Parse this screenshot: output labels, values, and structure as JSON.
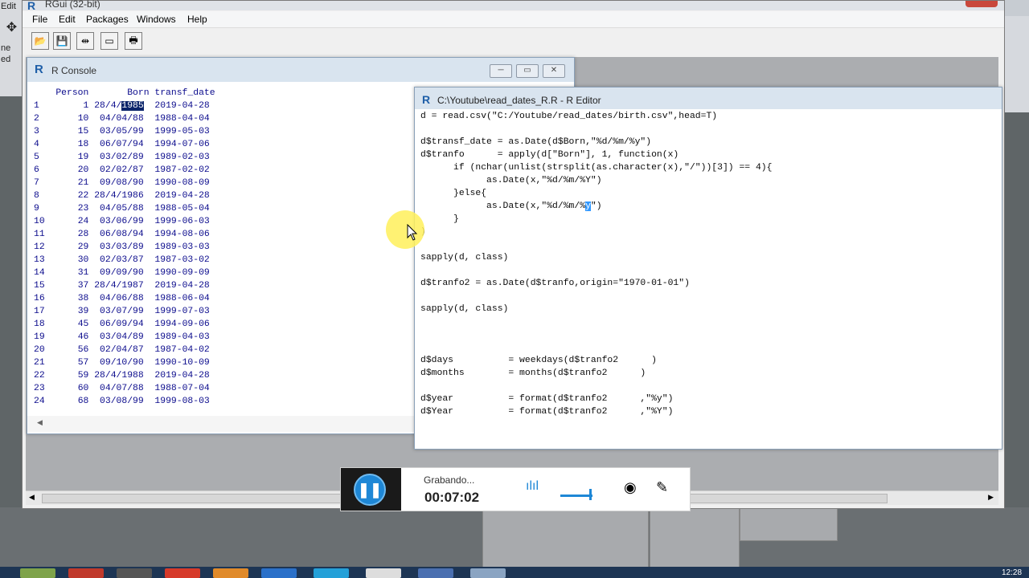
{
  "app": {
    "title": "RGui (32-bit)"
  },
  "left_strip": [
    "Edit",
    "ne",
    "ed"
  ],
  "menu": {
    "file": "File",
    "edit": "Edit",
    "packages": "Packages",
    "windows": "Windows",
    "help": "Help"
  },
  "toolbar": {
    "open_icon": "folder-open-icon",
    "save_icon": "save-icon",
    "copy_icon": "copy-paste-icon",
    "console_icon": "console-window-icon",
    "print_icon": "print-icon"
  },
  "console": {
    "title": "R Console",
    "header": "    Person       Born transf_date",
    "rows": [
      {
        "num": "1",
        "person": "1",
        "born_prefix": "28/4/",
        "born_sel": "1985",
        "date": "2019-04-28"
      },
      {
        "num": "2",
        "person": "10",
        "born": "04/04/88",
        "date": "1988-04-04"
      },
      {
        "num": "3",
        "person": "15",
        "born": "03/05/99",
        "date": "1999-05-03"
      },
      {
        "num": "4",
        "person": "18",
        "born": "06/07/94",
        "date": "1994-07-06"
      },
      {
        "num": "5",
        "person": "19",
        "born": "03/02/89",
        "date": "1989-02-03"
      },
      {
        "num": "6",
        "person": "20",
        "born": "02/02/87",
        "date": "1987-02-02"
      },
      {
        "num": "7",
        "person": "21",
        "born": "09/08/90",
        "date": "1990-08-09"
      },
      {
        "num": "8",
        "person": "22",
        "born": "28/4/1986",
        "date": "2019-04-28"
      },
      {
        "num": "9",
        "person": "23",
        "born": "04/05/88",
        "date": "1988-05-04"
      },
      {
        "num": "10",
        "person": "24",
        "born": "03/06/99",
        "date": "1999-06-03"
      },
      {
        "num": "11",
        "person": "28",
        "born": "06/08/94",
        "date": "1994-08-06"
      },
      {
        "num": "12",
        "person": "29",
        "born": "03/03/89",
        "date": "1989-03-03"
      },
      {
        "num": "13",
        "person": "30",
        "born": "02/03/87",
        "date": "1987-03-02"
      },
      {
        "num": "14",
        "person": "31",
        "born": "09/09/90",
        "date": "1990-09-09"
      },
      {
        "num": "15",
        "person": "37",
        "born": "28/4/1987",
        "date": "2019-04-28"
      },
      {
        "num": "16",
        "person": "38",
        "born": "04/06/88",
        "date": "1988-06-04"
      },
      {
        "num": "17",
        "person": "39",
        "born": "03/07/99",
        "date": "1999-07-03"
      },
      {
        "num": "18",
        "person": "45",
        "born": "06/09/94",
        "date": "1994-09-06"
      },
      {
        "num": "19",
        "person": "46",
        "born": "03/04/89",
        "date": "1989-04-03"
      },
      {
        "num": "20",
        "person": "56",
        "born": "02/04/87",
        "date": "1987-04-02"
      },
      {
        "num": "21",
        "person": "57",
        "born": "09/10/90",
        "date": "1990-10-09"
      },
      {
        "num": "22",
        "person": "59",
        "born": "28/4/1988",
        "date": "2019-04-28"
      },
      {
        "num": "23",
        "person": "60",
        "born": "04/07/88",
        "date": "1988-07-04"
      },
      {
        "num": "24",
        "person": "68",
        "born": "03/08/99",
        "date": "1999-08-03"
      }
    ]
  },
  "editor": {
    "title": "C:\\Youtube\\read_dates_R.R - R Editor",
    "lines": [
      "d = read.csv(\"C:/Youtube/read_dates/birth.csv\",head=T)",
      "",
      "d$transf_date = as.Date(d$Born,\"%d/%m/%y\")",
      "d$tranfo      = apply(d[\"Born\"], 1, function(x)",
      "      if (nchar(unlist(strsplit(as.character(x),\"/\"))[3]) == 4){",
      "            as.Date(x,\"%d/%m/%Y\")",
      "      }else{",
      "            as.Date(x,\"%d/%m/%",
      "      }",
      ")",
      "",
      "sapply(d, class)",
      "",
      "d$tranfo2 = as.Date(d$tranfo,origin=\"1970-01-01\")",
      "",
      "sapply(d, class)",
      "",
      "",
      "",
      "d$days          = weekdays(d$tranfo2      )",
      "d$months        = months(d$tranfo2      )",
      "",
      "d$year          = format(d$tranfo2      ,\"%y\")",
      "d$Year          = format(d$tranfo2      ,\"%Y\")"
    ],
    "line8_sel": "y",
    "line8_tail": "\")"
  },
  "recorder": {
    "status": "Grabando...",
    "time": "00:07:02",
    "pause_icon": "pause-icon",
    "audio_icon": "audio-levels-icon",
    "webcam_icon": "webcam-icon",
    "pen_icon": "pen-icon",
    "volume_level": 0.85
  },
  "taskbar": {
    "clock": "12:28"
  },
  "colors": {
    "accent": "#1e87d6",
    "selection": "#0a246a",
    "console_text": "#0a0a8c"
  }
}
